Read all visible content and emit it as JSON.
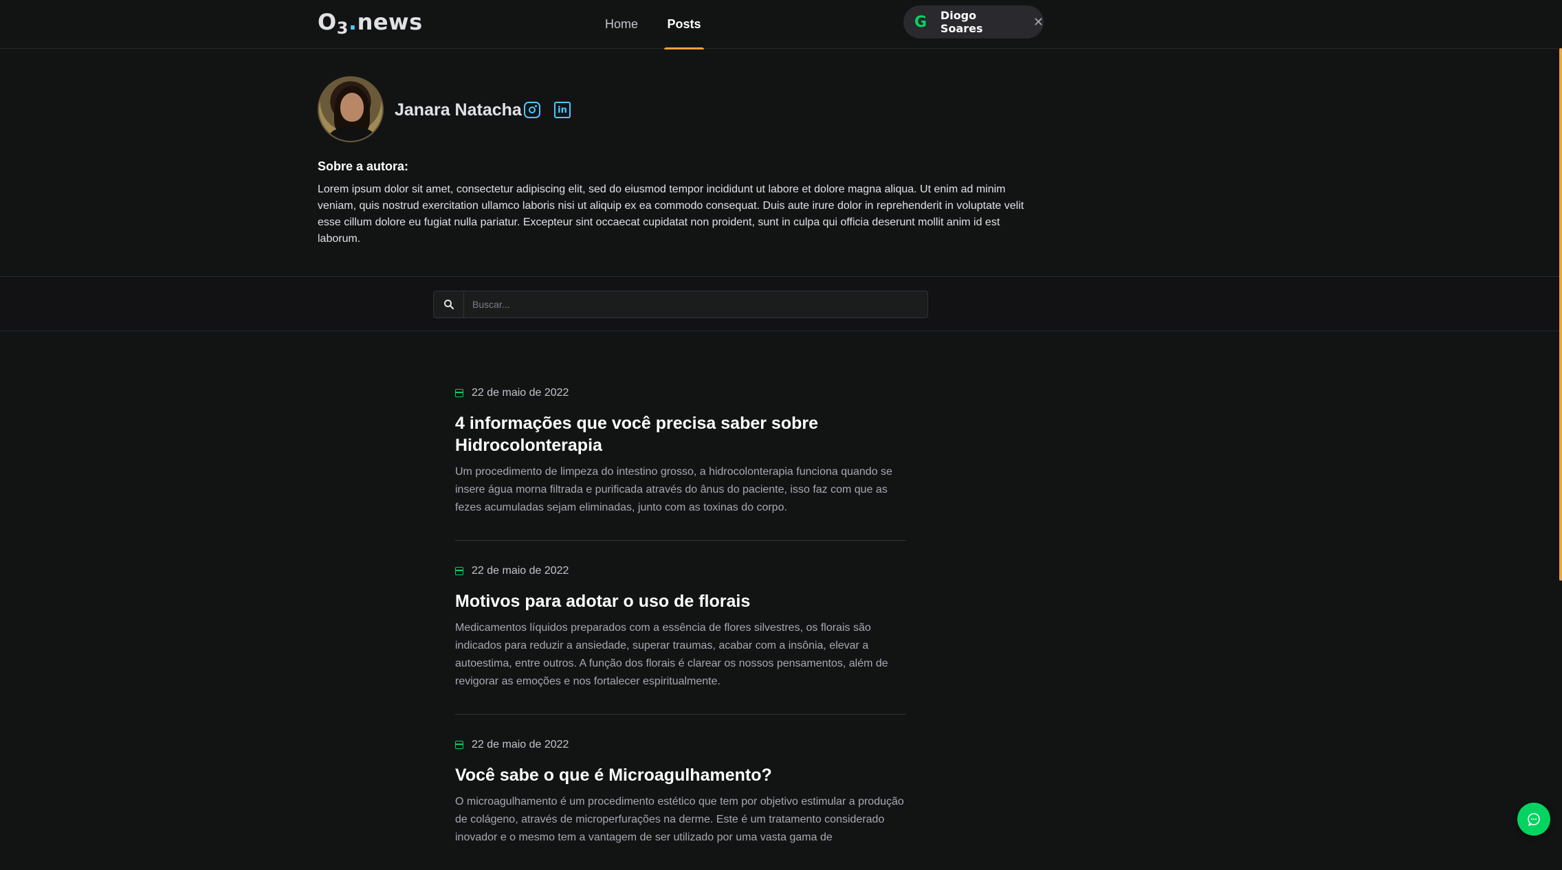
{
  "header": {
    "logo_main": "O",
    "logo_sub": "3",
    "logo_dot": ".",
    "logo_rest": "news",
    "nav": [
      {
        "label": "Home",
        "active": false
      },
      {
        "label": "Posts",
        "active": true
      }
    ],
    "user": {
      "provider_icon": "google-icon",
      "provider_letter": "G",
      "name": "Diogo Soares",
      "close_glyph": "✕"
    }
  },
  "author": {
    "name": "Janara Natacha",
    "social": [
      {
        "icon": "instagram-icon"
      },
      {
        "icon": "linkedin-icon",
        "glyph": "in"
      }
    ],
    "about_title": "Sobre a autora:",
    "about_text": "Lorem ipsum dolor sit amet, consectetur adipiscing elit, sed do eiusmod tempor incididunt ut labore et dolore magna aliqua. Ut enim ad minim veniam, quis nostrud exercitation ullamco laboris nisi ut aliquip ex ea commodo consequat. Duis aute irure dolor in reprehenderit in voluptate velit esse cillum dolore eu fugiat nulla pariatur. Excepteur sint occaecat cupidatat non proident, sunt in culpa qui officia deserunt mollit anim id est laborum."
  },
  "search": {
    "placeholder": "Buscar..."
  },
  "posts": [
    {
      "date": "22 de maio de 2022",
      "title": "4 informações que você precisa saber sobre Hidrocolonterapia",
      "excerpt": "Um procedimento de limpeza do intestino grosso, a hidrocolonterapia funciona quando se insere água morna filtrada e purificada através do ânus do paciente, isso faz com que as fezes acumuladas sejam eliminadas, junto com as toxinas do corpo."
    },
    {
      "date": "22 de maio de 2022",
      "title": "Motivos para adotar o uso de florais",
      "excerpt": "Medicamentos líquidos preparados com a essência de flores silvestres, os florais são indicados para reduzir a ansiedade, superar traumas, acabar com a insônia, elevar a autoestima, entre outros. A função dos florais é clarear os nossos pensamentos, além de revigorar as emoções e nos fortalecer espiritualmente."
    },
    {
      "date": "22 de maio de 2022",
      "title": "Você sabe o que é Microagulhamento?",
      "excerpt": "O microagulhamento é um procedimento estético que tem por objetivo estimular a produção de colágeno, através de microperfurações na derme. Este é um tratamento considerado inovador e o mesmo tem a vantagem de ser utilizado por uma vasta gama de"
    }
  ],
  "colors": {
    "accent_orange": "#f2a33a",
    "accent_green": "#04d361",
    "accent_blue": "#4ec8ff",
    "background": "#121414"
  }
}
